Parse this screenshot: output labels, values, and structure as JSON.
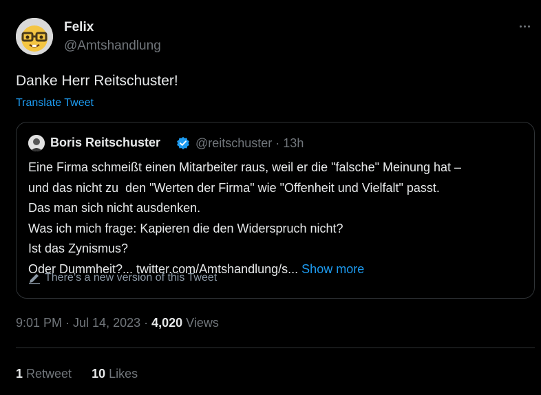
{
  "author": {
    "name": "Felix",
    "handle": "@Amtshandlung",
    "avatar": "nerd-face-emoji"
  },
  "tweet": {
    "text": "Danke Herr Reitschuster!",
    "translate_label": "Translate Tweet"
  },
  "quoted": {
    "name": "Boris Reitschuster",
    "handle_time": "@reitschuster · 13h",
    "verified_color": "#1d9bf0",
    "lines": [
      "Eine Firma schmeißt einen Mitarbeiter raus, weil er die \"falsche\" Meinung hat –",
      "und das nicht zu  den \"Werten der Firma\" wie \"Offenheit und Vielfalt\" passt.",
      "Das man sich nicht ausdenken.",
      "Was ich mich frage: Kapieren die den Widerspruch nicht?",
      "Ist das Zynismus?",
      "Oder Dummheit?... twitter.com/Amtshandlung/s..."
    ],
    "show_more": "Show more",
    "version_notice": "There’s a new version of this Tweet"
  },
  "meta": {
    "datetime": "9:01 PM · Jul 14, 2023 · ",
    "views_count": "4,020",
    "views_label": " Views"
  },
  "stats": {
    "retweets_count": "1",
    "retweets_label": " Retweet",
    "likes_count": "10",
    "likes_label": " Likes"
  },
  "colors": {
    "background": "#000000",
    "text": "#e7e9ea",
    "muted": "#71767b",
    "link": "#1d9bf0"
  }
}
